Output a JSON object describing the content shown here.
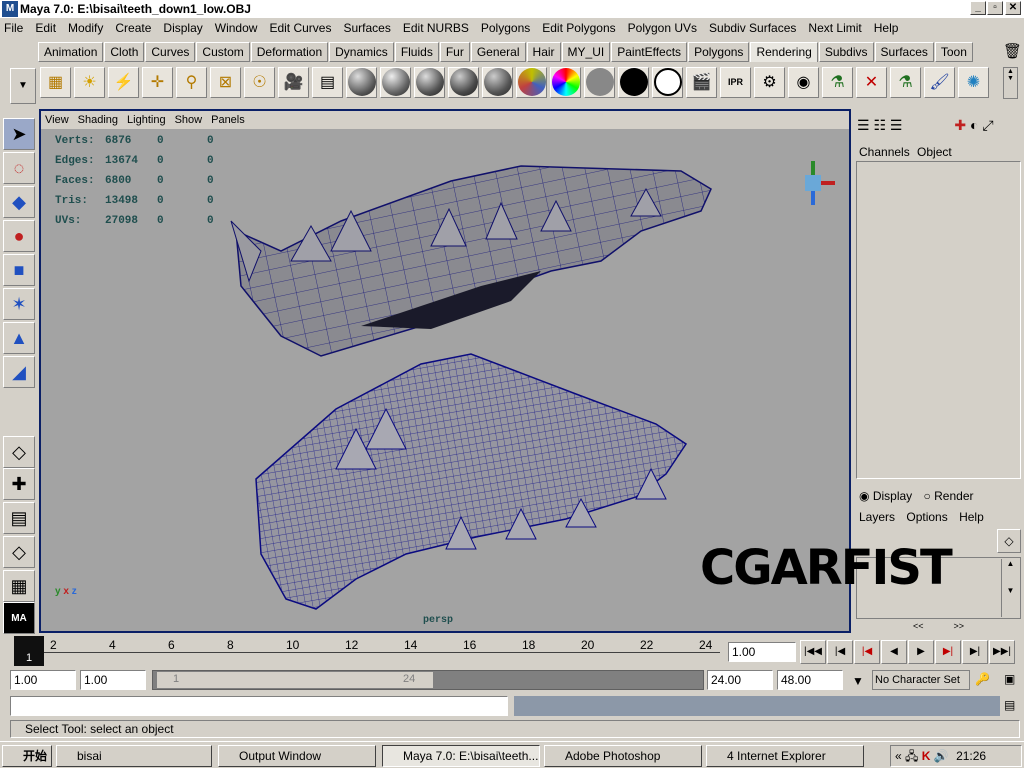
{
  "window": {
    "title": "Maya 7.0: E:\\bisai\\teeth_down1_low.OBJ"
  },
  "menu": [
    "File",
    "Edit",
    "Modify",
    "Create",
    "Display",
    "Window",
    "Edit Curves",
    "Surfaces",
    "Edit NURBS",
    "Polygons",
    "Edit Polygons",
    "Polygon UVs",
    "Subdiv Surfaces",
    "Next Limit",
    "Help"
  ],
  "shelf_tabs": [
    "Animation",
    "Cloth",
    "Curves",
    "Custom",
    "Deformation",
    "Dynamics",
    "Fluids",
    "Fur",
    "General",
    "Hair",
    "MY_UI",
    "PaintEffects",
    "Polygons",
    "Rendering",
    "Subdivs",
    "Surfaces",
    "Toon"
  ],
  "active_shelf_tab": "Rendering",
  "viewport": {
    "menu": [
      "View",
      "Shading",
      "Lighting",
      "Show",
      "Panels"
    ],
    "stats": [
      {
        "label": "Verts:",
        "v1": "6876",
        "v2": "0",
        "v3": "0"
      },
      {
        "label": "Edges:",
        "v1": "13674",
        "v2": "0",
        "v3": "0"
      },
      {
        "label": "Faces:",
        "v1": "6800",
        "v2": "0",
        "v3": "0"
      },
      {
        "label": "Tris:",
        "v1": "13498",
        "v2": "0",
        "v3": "0"
      },
      {
        "label": "UVs:",
        "v1": "27098",
        "v2": "0",
        "v3": "0"
      }
    ],
    "camera": "persp",
    "axis_x": "x",
    "axis_y": "y",
    "axis_z": "z"
  },
  "channel_box": {
    "tabs": [
      "Channels",
      "Object"
    ]
  },
  "layer_editor": {
    "display_label": "Display",
    "render_label": "Render",
    "menu": [
      "Layers",
      "Options",
      "Help"
    ]
  },
  "watermark": "CGARFIST",
  "timeline": {
    "ticks": [
      "2",
      "4",
      "6",
      "8",
      "10",
      "12",
      "14",
      "16",
      "18",
      "20",
      "22",
      "24"
    ],
    "current": "1",
    "current_time": "1.00"
  },
  "range": {
    "start": "1.00",
    "playback_start": "1.00",
    "slider_start": "1",
    "slider_end": "24",
    "playback_end": "24.00",
    "end": "48.00",
    "character_set": "No Character Set"
  },
  "help_line": "Select Tool: select an object",
  "taskbar": {
    "start": "开始",
    "tasks": [
      "bisai",
      "Output Window",
      "Maya 7.0: E:\\bisai\\teeth...",
      "Adobe Photoshop",
      "4  Internet Explorer"
    ],
    "clock": "21:26"
  }
}
